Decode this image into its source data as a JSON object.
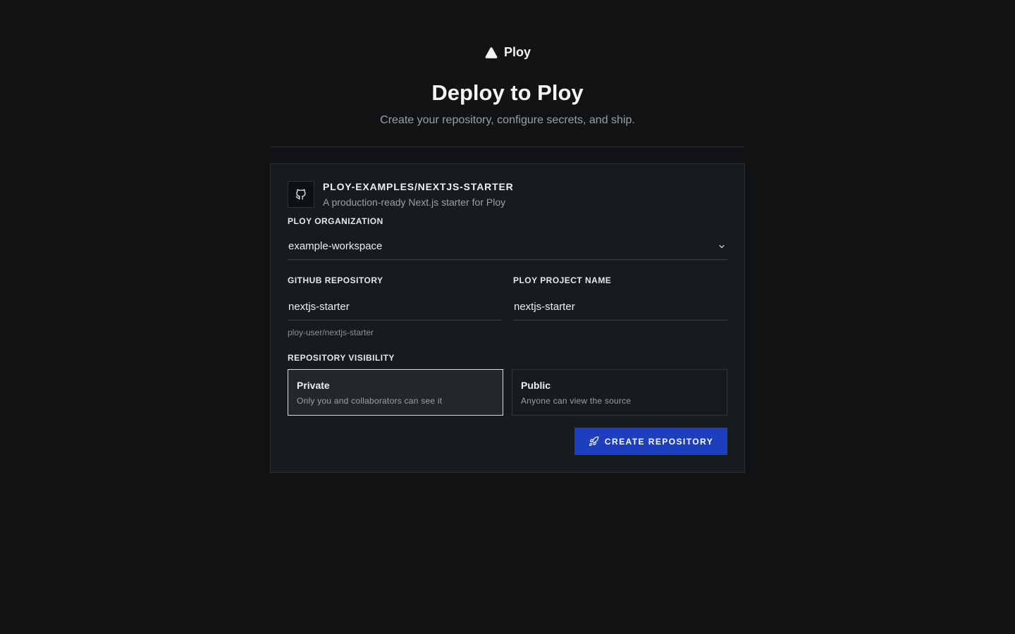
{
  "brand": {
    "name": "Ploy",
    "icon": "triangle-logo-icon"
  },
  "header": {
    "title": "Deploy to Ploy",
    "subtitle": "Create your repository, configure secrets, and ship."
  },
  "repo": {
    "icon": "github-icon",
    "name": "PLOY-EXAMPLES/NEXTJS-STARTER",
    "description": "A production-ready Next.js starter for Ploy"
  },
  "organization": {
    "label": "PLOY ORGANIZATION",
    "value": "example-workspace",
    "icon": "chevron-down-icon"
  },
  "github_repository": {
    "label": "GITHUB REPOSITORY",
    "value": "nextjs-starter",
    "hint": "ploy-user/nextjs-starter"
  },
  "project_name": {
    "label": "PLOY PROJECT NAME",
    "value": "nextjs-starter"
  },
  "visibility": {
    "label": "REPOSITORY VISIBILITY",
    "selected": "private",
    "options": [
      {
        "id": "private",
        "title": "Private",
        "description": "Only you and collaborators can see it"
      },
      {
        "id": "public",
        "title": "Public",
        "description": "Anyone can view the source"
      }
    ]
  },
  "actions": {
    "create_label": "CREATE REPOSITORY",
    "create_icon": "rocket-icon"
  },
  "colors": {
    "background": "#111315",
    "card": "#171b1e",
    "accent": "#1d3fbf"
  }
}
